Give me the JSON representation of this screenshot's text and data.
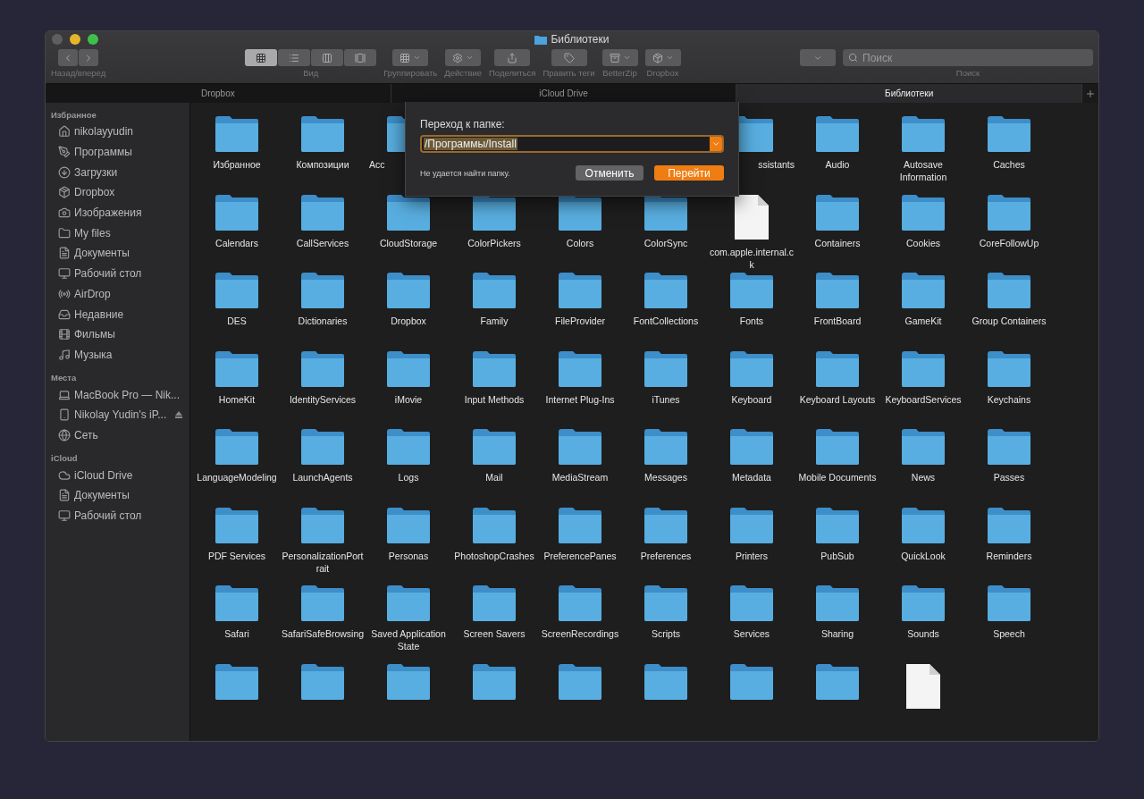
{
  "window": {
    "title": "Библиотеки"
  },
  "toolbar": {
    "nav": {
      "label": "Назад/вперед"
    },
    "view": {
      "label": "Вид",
      "options": [
        {
          "selected": true
        },
        {
          "selected": false
        },
        {
          "selected": false
        },
        {
          "selected": false
        }
      ]
    },
    "buttons": [
      {
        "label": "Группировать",
        "kind": "group"
      },
      {
        "label": "Действие",
        "kind": "action"
      },
      {
        "label": "Поделиться",
        "kind": "share"
      },
      {
        "label": "Править теги",
        "kind": "tags"
      },
      {
        "label": "BetterZip",
        "kind": "betterzip"
      },
      {
        "label": "Dropbox",
        "kind": "dropbox"
      }
    ],
    "search": {
      "placeholder": "Поиск",
      "label": "Поиск"
    }
  },
  "tabs": [
    {
      "label": "Dropbox",
      "selected": false
    },
    {
      "label": "iCloud Drive",
      "selected": false
    },
    {
      "label": "Библиотеки",
      "selected": true
    }
  ],
  "sidebar": {
    "sections": [
      {
        "title": "Избранное",
        "items": [
          {
            "label": "nikolayyudin"
          },
          {
            "label": "Программы"
          },
          {
            "label": "Загрузки"
          },
          {
            "label": "Dropbox"
          },
          {
            "label": "Изображения"
          },
          {
            "label": "My files"
          },
          {
            "label": "Документы"
          },
          {
            "label": "Рабочий стол"
          },
          {
            "label": "AirDrop"
          },
          {
            "label": "Недавние"
          },
          {
            "label": "Фильмы"
          },
          {
            "label": "Музыка"
          }
        ]
      },
      {
        "title": "Места",
        "items": [
          {
            "label": "MacBook Pro — Nik..."
          },
          {
            "label": "Nikolay Yudin's iP...",
            "ejectable": true
          },
          {
            "label": "Сеть"
          }
        ]
      },
      {
        "title": "iCloud",
        "items": [
          {
            "label": "iCloud Drive"
          },
          {
            "label": "Документы"
          },
          {
            "label": "Рабочий стол"
          }
        ]
      }
    ]
  },
  "files": [
    [
      {
        "label": "Избранное",
        "kind": "folder"
      },
      {
        "label": "Композиции",
        "kind": "folder"
      },
      {
        "label": "Acc",
        "kind": "folder",
        "clipped_end": true
      },
      {
        "label": "ssistants",
        "kind": "folder",
        "clipped_start": true
      },
      {
        "label": "Audio",
        "kind": "folder"
      },
      {
        "label": "Autosave Information",
        "kind": "folder"
      },
      {
        "label": "Caches",
        "kind": "folder"
      }
    ],
    [
      {
        "label": "Calendars",
        "kind": "folder"
      },
      {
        "label": "CallServices",
        "kind": "folder"
      },
      {
        "label": "CloudStorage",
        "kind": "folder"
      },
      {
        "label": "ColorPickers",
        "kind": "folder"
      },
      {
        "label": "Colors",
        "kind": "folder"
      },
      {
        "label": "ColorSync",
        "kind": "folder"
      },
      {
        "label": "com.apple.internal.ck",
        "kind": "document"
      },
      {
        "label": "Containers",
        "kind": "folder"
      },
      {
        "label": "Cookies",
        "kind": "folder"
      },
      {
        "label": "CoreFollowUp",
        "kind": "folder"
      }
    ],
    [
      {
        "label": "DES",
        "kind": "folder"
      },
      {
        "label": "Dictionaries",
        "kind": "folder"
      },
      {
        "label": "Dropbox",
        "kind": "folder"
      },
      {
        "label": "Family",
        "kind": "folder"
      },
      {
        "label": "FileProvider",
        "kind": "folder"
      },
      {
        "label": "FontCollections",
        "kind": "folder"
      },
      {
        "label": "Fonts",
        "kind": "folder"
      },
      {
        "label": "FrontBoard",
        "kind": "folder"
      },
      {
        "label": "GameKit",
        "kind": "folder"
      },
      {
        "label": "Group Containers",
        "kind": "folder"
      }
    ],
    [
      {
        "label": "HomeKit",
        "kind": "folder"
      },
      {
        "label": "IdentityServices",
        "kind": "folder"
      },
      {
        "label": "iMovie",
        "kind": "folder"
      },
      {
        "label": "Input Methods",
        "kind": "folder"
      },
      {
        "label": "Internet Plug-Ins",
        "kind": "folder"
      },
      {
        "label": "iTunes",
        "kind": "folder"
      },
      {
        "label": "Keyboard",
        "kind": "folder"
      },
      {
        "label": "Keyboard Layouts",
        "kind": "folder"
      },
      {
        "label": "KeyboardServices",
        "kind": "folder"
      },
      {
        "label": "Keychains",
        "kind": "folder"
      }
    ],
    [
      {
        "label": "LanguageModeling",
        "kind": "folder"
      },
      {
        "label": "LaunchAgents",
        "kind": "folder"
      },
      {
        "label": "Logs",
        "kind": "folder"
      },
      {
        "label": "Mail",
        "kind": "folder"
      },
      {
        "label": "MediaStream",
        "kind": "folder"
      },
      {
        "label": "Messages",
        "kind": "folder"
      },
      {
        "label": "Metadata",
        "kind": "folder"
      },
      {
        "label": "Mobile Documents",
        "kind": "folder"
      },
      {
        "label": "News",
        "kind": "folder"
      },
      {
        "label": "Passes",
        "kind": "folder"
      }
    ],
    [
      {
        "label": "PDF Services",
        "kind": "folder"
      },
      {
        "label": "PersonalizationPortrait",
        "kind": "folder"
      },
      {
        "label": "Personas",
        "kind": "folder"
      },
      {
        "label": "PhotoshopCrashes",
        "kind": "folder"
      },
      {
        "label": "PreferencePanes",
        "kind": "folder"
      },
      {
        "label": "Preferences",
        "kind": "folder"
      },
      {
        "label": "Printers",
        "kind": "folder"
      },
      {
        "label": "PubSub",
        "kind": "folder"
      },
      {
        "label": "QuickLook",
        "kind": "folder"
      },
      {
        "label": "Reminders",
        "kind": "folder"
      }
    ],
    [
      {
        "label": "Safari",
        "kind": "folder"
      },
      {
        "label": "SafariSafeBrowsing",
        "kind": "folder"
      },
      {
        "label": "Saved Application State",
        "kind": "folder"
      },
      {
        "label": "Screen Savers",
        "kind": "folder"
      },
      {
        "label": "ScreenRecordings",
        "kind": "folder"
      },
      {
        "label": "Scripts",
        "kind": "folder"
      },
      {
        "label": "Services",
        "kind": "folder"
      },
      {
        "label": "Sharing",
        "kind": "folder"
      },
      {
        "label": "Sounds",
        "kind": "folder"
      },
      {
        "label": "Speech",
        "kind": "folder"
      }
    ],
    [
      {
        "kind": "folder"
      },
      {
        "kind": "folder"
      },
      {
        "kind": "folder"
      },
      {
        "kind": "folder"
      },
      {
        "kind": "folder"
      },
      {
        "kind": "folder"
      },
      {
        "kind": "folder"
      },
      {
        "kind": "folder"
      },
      {
        "kind": "document"
      }
    ]
  ],
  "dialog": {
    "title": "Переход к папке:",
    "value": "/Программы/Install",
    "error": "Не удается найти папку.",
    "buttons": [
      {
        "label": "Отменить",
        "primary": false
      },
      {
        "label": "Перейти",
        "primary": true
      }
    ]
  }
}
